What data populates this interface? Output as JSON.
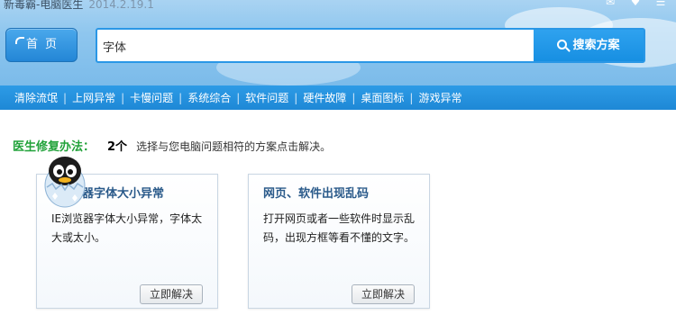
{
  "window": {
    "title": "新毒霸-电脑医生",
    "version": "2014.2.19.1"
  },
  "header": {
    "home_label": "首页",
    "search": {
      "value": "字体",
      "button_label": "搜索方案"
    },
    "top_icons": [
      "chat-icon",
      "heart-icon",
      "menu-icon"
    ]
  },
  "nav": {
    "items": [
      "清除流氓",
      "上网异常",
      "卡慢问题",
      "系统综合",
      "软件问题",
      "硬件故障",
      "桌面图标",
      "游戏异常"
    ]
  },
  "summary": {
    "label": "医生修复办法：",
    "count": "2个",
    "hint": "选择与您电脑问题相符的方案点击解决。"
  },
  "cards": [
    {
      "title": "器字体大小异常",
      "desc": "IE浏览器字体大小异常，字体太大或太小。",
      "button": "立即解决"
    },
    {
      "title": "网页、软件出现乱码",
      "desc": "打开网页或者一些软件时显示乱码，出现方框等看不懂的文字。",
      "button": "立即解决"
    }
  ],
  "colors": {
    "accent_blue": "#1e88d6",
    "summary_green": "#21a23a",
    "card_title": "#2a5a8a"
  }
}
